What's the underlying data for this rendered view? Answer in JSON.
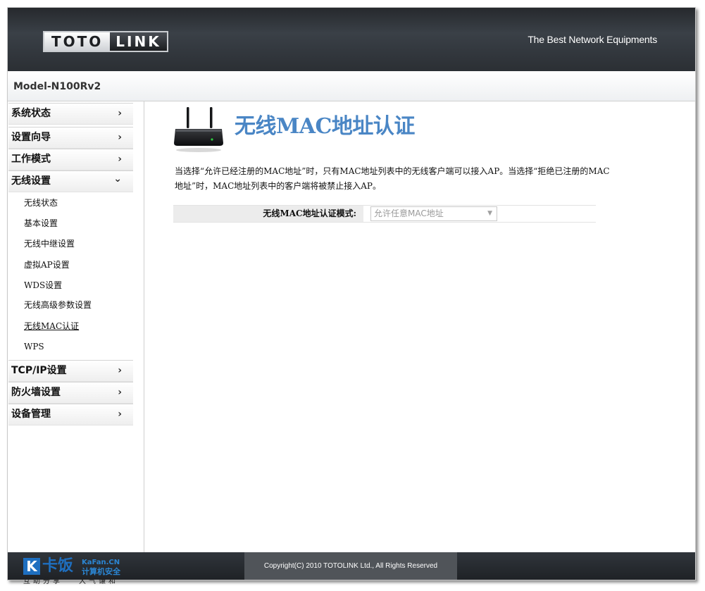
{
  "header": {
    "logo_left": "TOTO",
    "logo_right": "LINK",
    "tagline": "The Best Network Equipments",
    "model": "Model-N100Rv2"
  },
  "sidebar": {
    "items": [
      {
        "label": "系统状态",
        "chevron": "›"
      },
      {
        "label": "设置向导",
        "chevron": "›"
      },
      {
        "label": "工作模式",
        "chevron": "›"
      },
      {
        "label": "无线设置",
        "chevron": "⌄"
      },
      {
        "label": "TCP/IP设置",
        "chevron": "›"
      },
      {
        "label": "防火墙设置",
        "chevron": "›"
      },
      {
        "label": "设备管理",
        "chevron": "›"
      }
    ],
    "subitems": [
      {
        "label": "无线状态"
      },
      {
        "label": "基本设置"
      },
      {
        "label": "无线中继设置"
      },
      {
        "label": "虚拟AP设置"
      },
      {
        "label": "WDS设置"
      },
      {
        "label": "无线高级参数设置"
      },
      {
        "label": "无线MAC认证",
        "active": true
      },
      {
        "label": "WPS"
      }
    ]
  },
  "main": {
    "title": "无线MAC地址认证",
    "description": "当选择“允许已经注册的MAC地址”时，只有MAC地址列表中的无线客户端可以接入AP。当选择“拒绝已注册的MAC地址”时，MAC地址列表中的客户端将被禁止接入AP。",
    "form": {
      "label": "无线MAC地址认证模式:",
      "selected": "允许任意MAC地址",
      "arrow": "▼"
    }
  },
  "footer": {
    "copyright": "Copyright(C) 2010 TOTOLINK Ltd.,   All Rights Reserved"
  },
  "watermark": {
    "k": "K",
    "cn": "卡饭",
    "site": "KaFan.CN",
    "site_sub": "计算机安全",
    "slogan_left": "互助分享",
    "slogan_right": "大气谦和"
  },
  "icons": {
    "router": "router-icon",
    "chevron": "chevron-right-icon",
    "expanded": "chevron-down-icon"
  }
}
